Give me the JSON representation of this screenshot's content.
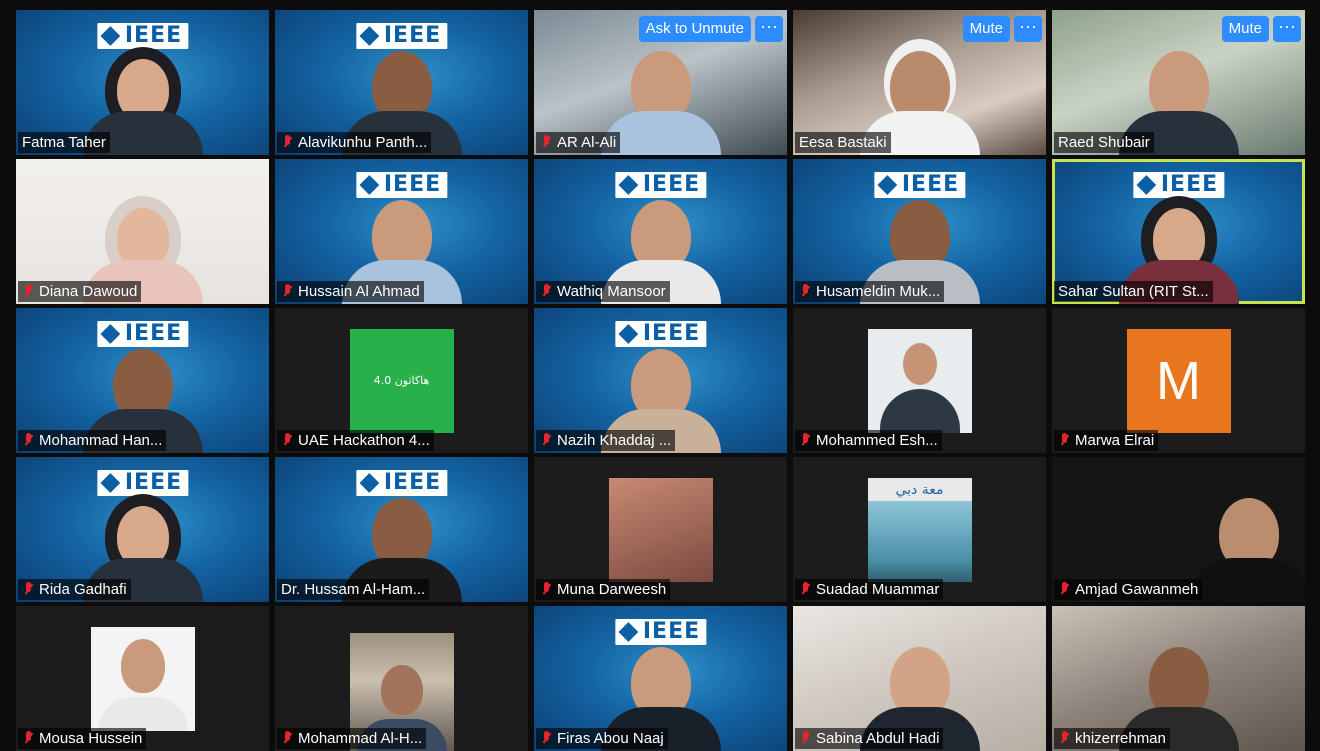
{
  "participants": [
    {
      "name": "Fatma Taher",
      "muted": false,
      "kind": "ieee"
    },
    {
      "name": "Alavikunhu Panth...",
      "muted": true,
      "kind": "ieee"
    },
    {
      "name": "AR Al-Ali",
      "muted": true,
      "kind": "photo",
      "button": "Ask to Unmute",
      "more": "···"
    },
    {
      "name": "Eesa Bastaki",
      "muted": false,
      "kind": "photo",
      "button": "Mute",
      "more": "···"
    },
    {
      "name": "Raed Shubair",
      "muted": false,
      "kind": "photo",
      "button": "Mute",
      "more": "···"
    },
    {
      "name": "Diana Dawoud",
      "muted": true,
      "kind": "photo"
    },
    {
      "name": "Hussain Al Ahmad",
      "muted": true,
      "kind": "ieee"
    },
    {
      "name": "Wathiq Mansoor",
      "muted": true,
      "kind": "ieee"
    },
    {
      "name": "Husameldin Muk...",
      "muted": true,
      "kind": "ieee"
    },
    {
      "name": "Sahar Sultan (RIT St...",
      "muted": false,
      "kind": "ieee",
      "active_speaker": true
    },
    {
      "name": "Mohammad Han...",
      "muted": true,
      "kind": "ieee"
    },
    {
      "name": "UAE Hackathon 4...",
      "muted": true,
      "kind": "thumbnail",
      "thumb_text": "هاكاثون 4.0"
    },
    {
      "name": "Nazih Khaddaj ...",
      "muted": true,
      "kind": "ieee"
    },
    {
      "name": "Mohammed Esh...",
      "muted": true,
      "kind": "thumbnail"
    },
    {
      "name": "Marwa Elrai",
      "muted": true,
      "kind": "avatar",
      "initial": "M"
    },
    {
      "name": "Rida Gadhafi",
      "muted": true,
      "kind": "ieee"
    },
    {
      "name": "Dr. Hussam Al-Ham...",
      "muted": false,
      "kind": "ieee"
    },
    {
      "name": "Muna Darweesh",
      "muted": true,
      "kind": "thumbnail"
    },
    {
      "name": "Suadad Muammar",
      "muted": true,
      "kind": "thumbnail",
      "thumb_text": "معة دبي"
    },
    {
      "name": "Amjad Gawanmeh",
      "muted": true,
      "kind": "photo"
    },
    {
      "name": "Mousa Hussein",
      "muted": true,
      "kind": "thumbnail"
    },
    {
      "name": "Mohammad Al-H...",
      "muted": true,
      "kind": "thumbnail"
    },
    {
      "name": "Firas Abou Naaj",
      "muted": true,
      "kind": "ieee"
    },
    {
      "name": "Sabina Abdul Hadi",
      "muted": true,
      "kind": "photo"
    },
    {
      "name": "khizerrehman",
      "muted": true,
      "kind": "photo"
    }
  ],
  "ieee_logo_text": "IEEE",
  "colors": {
    "active_speaker_border": "#c6e44e",
    "button_blue": "#2d8cff",
    "muted_icon": "#e5252d",
    "background": "#0c0c0c"
  }
}
